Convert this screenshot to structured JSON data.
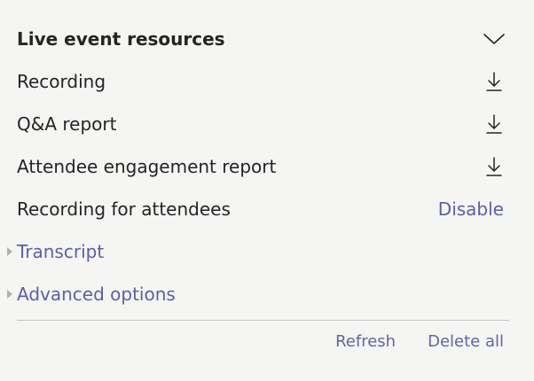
{
  "panel": {
    "title": "Live event resources",
    "collapse_icon": "chevron-down-icon"
  },
  "resources": [
    {
      "label": "Recording",
      "icon": "download-icon"
    },
    {
      "label": "Q&A report",
      "icon": "download-icon"
    },
    {
      "label": "Attendee engagement report",
      "icon": "download-icon"
    }
  ],
  "recording_for_attendees": {
    "label": "Recording for attendees",
    "action": "Disable"
  },
  "sections": [
    {
      "label": "Transcript",
      "icon": "triangle-right-icon"
    },
    {
      "label": "Advanced options",
      "icon": "triangle-right-icon"
    }
  ],
  "footer": {
    "refresh_label": "Refresh",
    "delete_all_label": "Delete all"
  },
  "colors": {
    "background": "#f5f5f4",
    "text": "#242424",
    "accent": "#6264a7",
    "divider": "#c8c6c4"
  }
}
